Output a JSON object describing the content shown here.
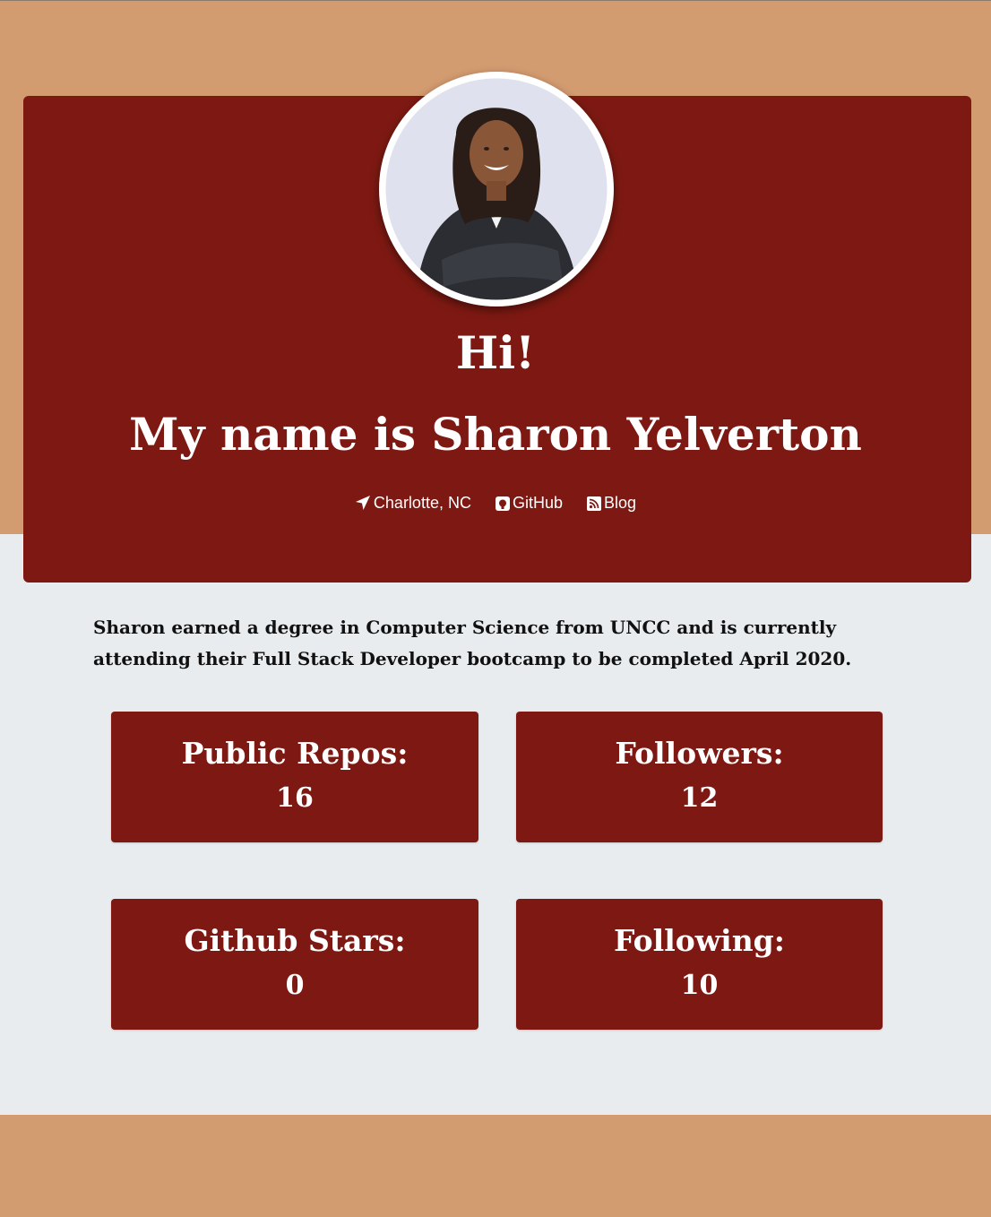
{
  "header": {
    "greeting": "Hi!",
    "name_line": "My name is Sharon Yelverton",
    "avatar_alt": "Profile photo of Sharon Yelverton"
  },
  "links": [
    {
      "label": "Charlotte, NC",
      "icon": "location-arrow-icon"
    },
    {
      "label": "GitHub",
      "icon": "github-icon"
    },
    {
      "label": "Blog",
      "icon": "rss-icon"
    }
  ],
  "bio": "Sharon earned a degree in Computer Science from UNCC and is currently attending their Full Stack Developer bootcamp to be completed April 2020.",
  "stats": {
    "repos": {
      "label": "Public Repos:",
      "value": "16"
    },
    "followers": {
      "label": "Followers:",
      "value": "12"
    },
    "stars": {
      "label": "Github Stars:",
      "value": "0"
    },
    "following": {
      "label": "Following:",
      "value": "10"
    }
  },
  "colors": {
    "band": "#d39b70",
    "hero": "#7d1912",
    "background": "#e9ecee",
    "text_light": "#ffffff",
    "text_dark": "#111111"
  }
}
